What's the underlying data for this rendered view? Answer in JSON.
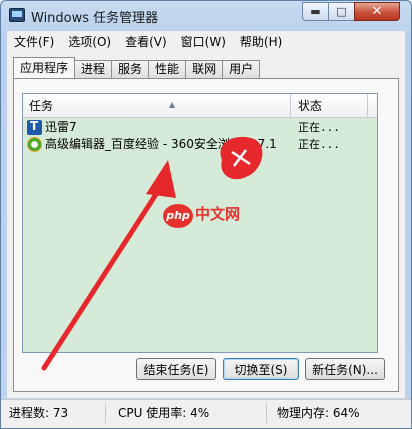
{
  "window": {
    "title": "Windows 任务管理器",
    "caption_min": "▬",
    "caption_max": "□",
    "caption_close": "✕"
  },
  "menu": [
    "文件(F)",
    "选项(O)",
    "查看(V)",
    "窗口(W)",
    "帮助(H)"
  ],
  "tabs": [
    "应用程序",
    "进程",
    "服务",
    "性能",
    "联网",
    "用户"
  ],
  "active_tab": "应用程序",
  "list": {
    "columns": {
      "task": "任务",
      "status": "状态"
    },
    "rows": [
      {
        "icon": "xunlei-icon",
        "name": "迅雷7",
        "status": "正在..."
      },
      {
        "icon": "ie-browser-icon",
        "name": "高级编辑器_百度经验 - 360安全浏览器 7.1",
        "status": "正在..."
      }
    ]
  },
  "buttons": {
    "end_task": "结束任务(E)",
    "switch_to": "切换至(S)",
    "new_task": "新任务(N)..."
  },
  "statusbar": {
    "processes": "进程数: 73",
    "cpu": "CPU 使用率: 4%",
    "memory": "物理内存: 64%"
  },
  "overlays": {
    "watermark_badge": "php",
    "watermark_text": "中文网",
    "annotation_color": "#e6282d"
  },
  "colors": {
    "list_background": "#d5ebd8",
    "titlebar": "#c7dbf1",
    "close_button": "#c8513b"
  }
}
